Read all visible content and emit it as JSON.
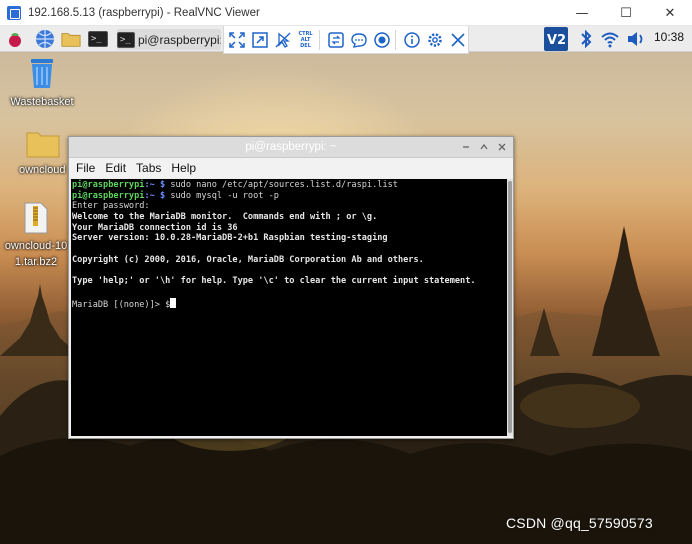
{
  "viewer": {
    "title": "192.168.5.13 (raspberrypi) - RealVNC Viewer",
    "minimize_glyph": "—",
    "maximize_glyph": "☐",
    "close_glyph": "✕"
  },
  "taskbar": {
    "task_label": "pi@raspberrypi: ~",
    "clock": "10:38",
    "icons": [
      "raspberry-menu-icon",
      "web-browser-icon",
      "file-manager-icon",
      "terminal-icon",
      "vnc-icon",
      "bluetooth-icon",
      "wifi-icon",
      "volume-icon"
    ]
  },
  "vnc_toolbar": {
    "buttons": [
      "fullscreen-icon",
      "scale-icon",
      "pointer-icon",
      "ctrl-alt-del-icon",
      "transfer-icon",
      "chat-icon",
      "record-icon",
      "info-icon",
      "settings-icon",
      "close-icon"
    ],
    "ctrl_alt_del_text": [
      "CTRL",
      "ALT",
      "DEL"
    ]
  },
  "desktop_icons": [
    {
      "label": "Wastebasket"
    },
    {
      "label": "owncloud"
    },
    {
      "label_line1": "owncloud-10",
      "label_line2": "1.tar.bz2"
    }
  ],
  "terminal": {
    "title": "pi@raspberrypi: ~",
    "menus": [
      "File",
      "Edit",
      "Tabs",
      "Help"
    ],
    "prompt_user": "pi@raspberrypi",
    "prompt_path": ":~ $ ",
    "lines": {
      "cmd1": "sudo nano /etc/apt/sources.list.d/raspi.list",
      "cmd2": "sudo mysql -u root -p",
      "l3": "Enter password:",
      "l4": "Welcome to the MariaDB monitor.  Commands end with ; or \\g.",
      "l5": "Your MariaDB connection id is 36",
      "l6": "Server version: 10.0.28-MariaDB-2+b1 Raspbian testing-staging",
      "l7": "",
      "l8": "Copyright (c) 2000, 2016, Oracle, MariaDB Corporation Ab and others.",
      "l9": "",
      "l10": "Type 'help;' or '\\h' for help. Type '\\c' to clear the current input statement.",
      "l11": "",
      "l12": "MariaDB [(none)]> $"
    }
  },
  "watermark": "CSDN @qq_57590573"
}
